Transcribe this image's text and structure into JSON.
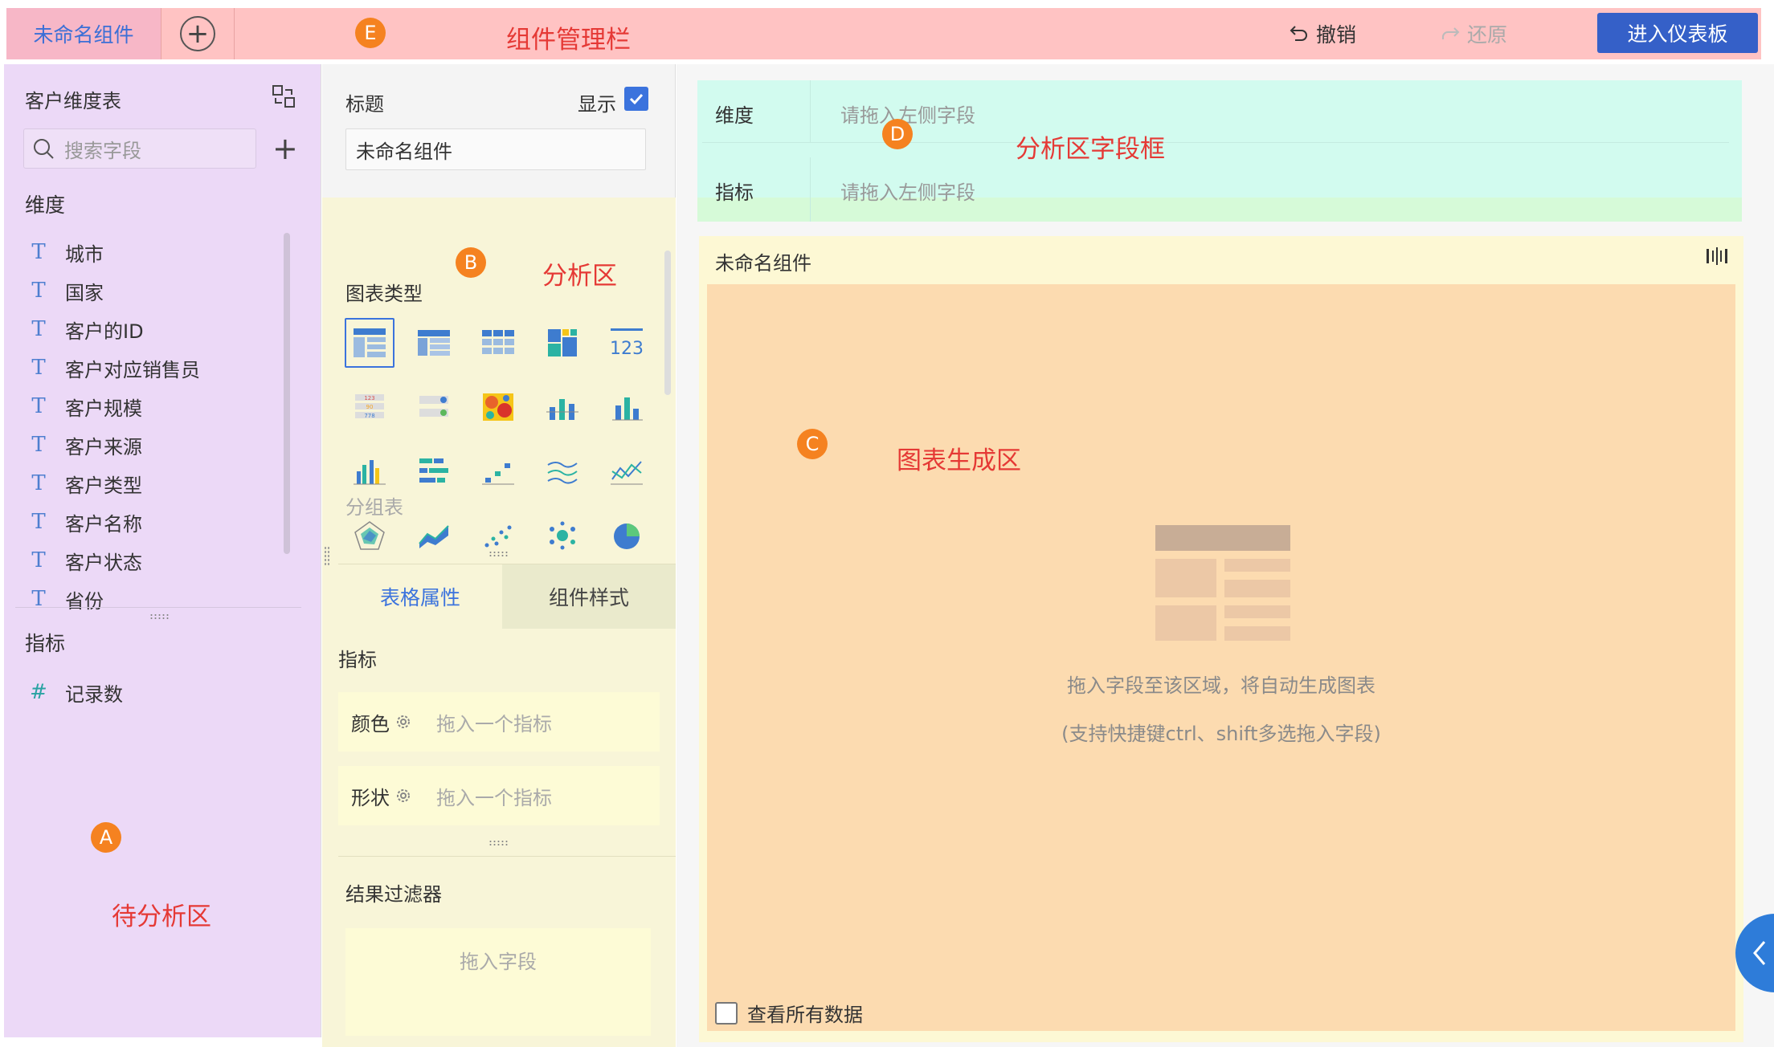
{
  "topbar": {
    "tab_label": "未命名组件",
    "badge": "E",
    "region_label": "组件管理栏",
    "undo_label": "撤销",
    "redo_label": "还原",
    "enter_dashboard_label": "进入仪表板"
  },
  "left": {
    "table_name": "客户维度表",
    "search_placeholder": "搜索字段",
    "dimension_heading": "维度",
    "dimensions": [
      "城市",
      "国家",
      "客户的ID",
      "客户对应销售员",
      "客户规模",
      "客户来源",
      "客户类型",
      "客户名称",
      "客户状态",
      "省份"
    ],
    "measure_heading": "指标",
    "measures": [
      "记录数"
    ],
    "badge": "A",
    "region_label": "待分析区"
  },
  "middle": {
    "title_label": "标题",
    "show_label": "显示",
    "title_value": "未命名组件",
    "badge": "B",
    "region_label": "分析区",
    "chart_type_label": "图表类型",
    "chart_hover_label": "分组表",
    "tab_table_props": "表格属性",
    "tab_component_style": "组件样式",
    "metric_heading": "指标",
    "color_label": "颜色",
    "color_placeholder": "拖入一个指标",
    "shape_label": "形状",
    "shape_placeholder": "拖入一个指标",
    "filter_heading": "结果过滤器",
    "filter_placeholder": "拖入字段"
  },
  "right": {
    "dimension_label": "维度",
    "dimension_placeholder": "请拖入左侧字段",
    "measure_label": "指标",
    "measure_placeholder": "请拖入左侧字段",
    "badge_d": "D",
    "region_label_d": "分析区字段框",
    "component_title": "未命名组件",
    "badge_c": "C",
    "region_label_c": "图表生成区",
    "hint_line1": "拖入字段至该区域，将自动生成图表",
    "hint_line2": "(支持快捷键ctrl、shift多选拖入字段)",
    "view_all_label": "查看所有数据"
  },
  "colors": {
    "primary": "#3560c8",
    "accent_badge": "#f58220",
    "region_label": "#e53935"
  }
}
